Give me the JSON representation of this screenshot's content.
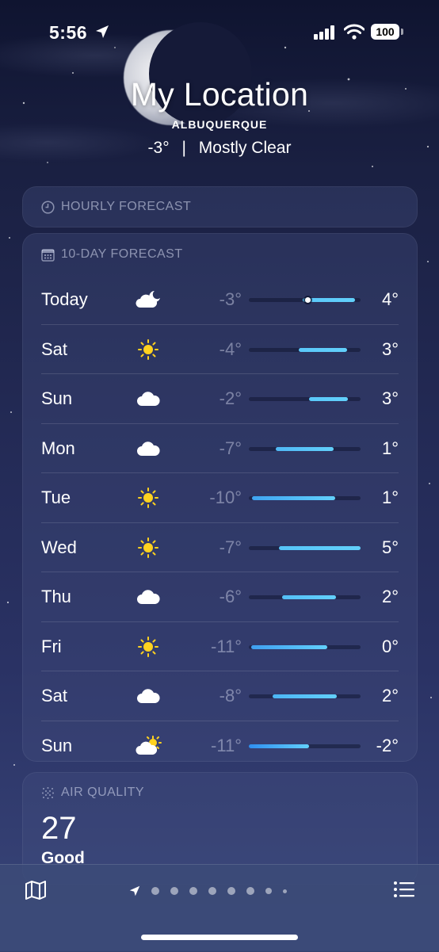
{
  "status": {
    "time": "5:56",
    "battery": "100"
  },
  "header": {
    "title": "My Location",
    "city": "ALBUQUERQUE",
    "current_temp": "-3°",
    "separator": "|",
    "condition": "Mostly Clear"
  },
  "hourly": {
    "label": "HOURLY FORECAST"
  },
  "ten_day": {
    "label": "10-DAY FORECAST",
    "days": [
      {
        "day": "Today",
        "icon": "partly-cloudy-night-icon",
        "low": "-3°",
        "high": "4°",
        "range_start": 0.48,
        "range_end": 0.95,
        "current_marker": 0.53,
        "color": "#5ac8fa"
      },
      {
        "day": "Sat",
        "icon": "sun-icon",
        "low": "-4°",
        "high": "3°",
        "range_start": 0.45,
        "range_end": 0.88,
        "color": "#5ac8fa"
      },
      {
        "day": "Sun",
        "icon": "cloud-icon",
        "low": "-2°",
        "high": "3°",
        "range_start": 0.54,
        "range_end": 0.89,
        "color": "#5ac8fa"
      },
      {
        "day": "Mon",
        "icon": "cloud-icon",
        "low": "-7°",
        "high": "1°",
        "range_start": 0.24,
        "range_end": 0.76,
        "color": "#50b8f5"
      },
      {
        "day": "Tue",
        "icon": "sun-icon",
        "low": "-10°",
        "high": "1°",
        "range_start": 0.03,
        "range_end": 0.77,
        "color": "#3fa4f2"
      },
      {
        "day": "Wed",
        "icon": "sun-icon",
        "low": "-7°",
        "high": "5°",
        "range_start": 0.27,
        "range_end": 1.0,
        "color": "#56c4f8"
      },
      {
        "day": "Thu",
        "icon": "cloud-icon",
        "low": "-6°",
        "high": "2°",
        "range_start": 0.3,
        "range_end": 0.78,
        "color": "#54bff7"
      },
      {
        "day": "Fri",
        "icon": "sun-icon",
        "low": "-11°",
        "high": "0°",
        "range_start": 0.02,
        "range_end": 0.7,
        "color": "#3f9ff0"
      },
      {
        "day": "Sat",
        "icon": "cloud-icon",
        "low": "-8°",
        "high": "2°",
        "range_start": 0.21,
        "range_end": 0.79,
        "color": "#4cb6f5"
      },
      {
        "day": "Sun",
        "icon": "partly-sunny-icon",
        "low": "-11°",
        "high": "-2°",
        "range_start": 0.0,
        "range_end": 0.54,
        "color": "#2f8ff0"
      }
    ]
  },
  "air_quality": {
    "label": "AIR QUALITY",
    "value": "27",
    "category": "Good"
  },
  "bottom_bar": {
    "map_icon": "map-icon",
    "list_icon": "list-icon",
    "pages": 9
  }
}
